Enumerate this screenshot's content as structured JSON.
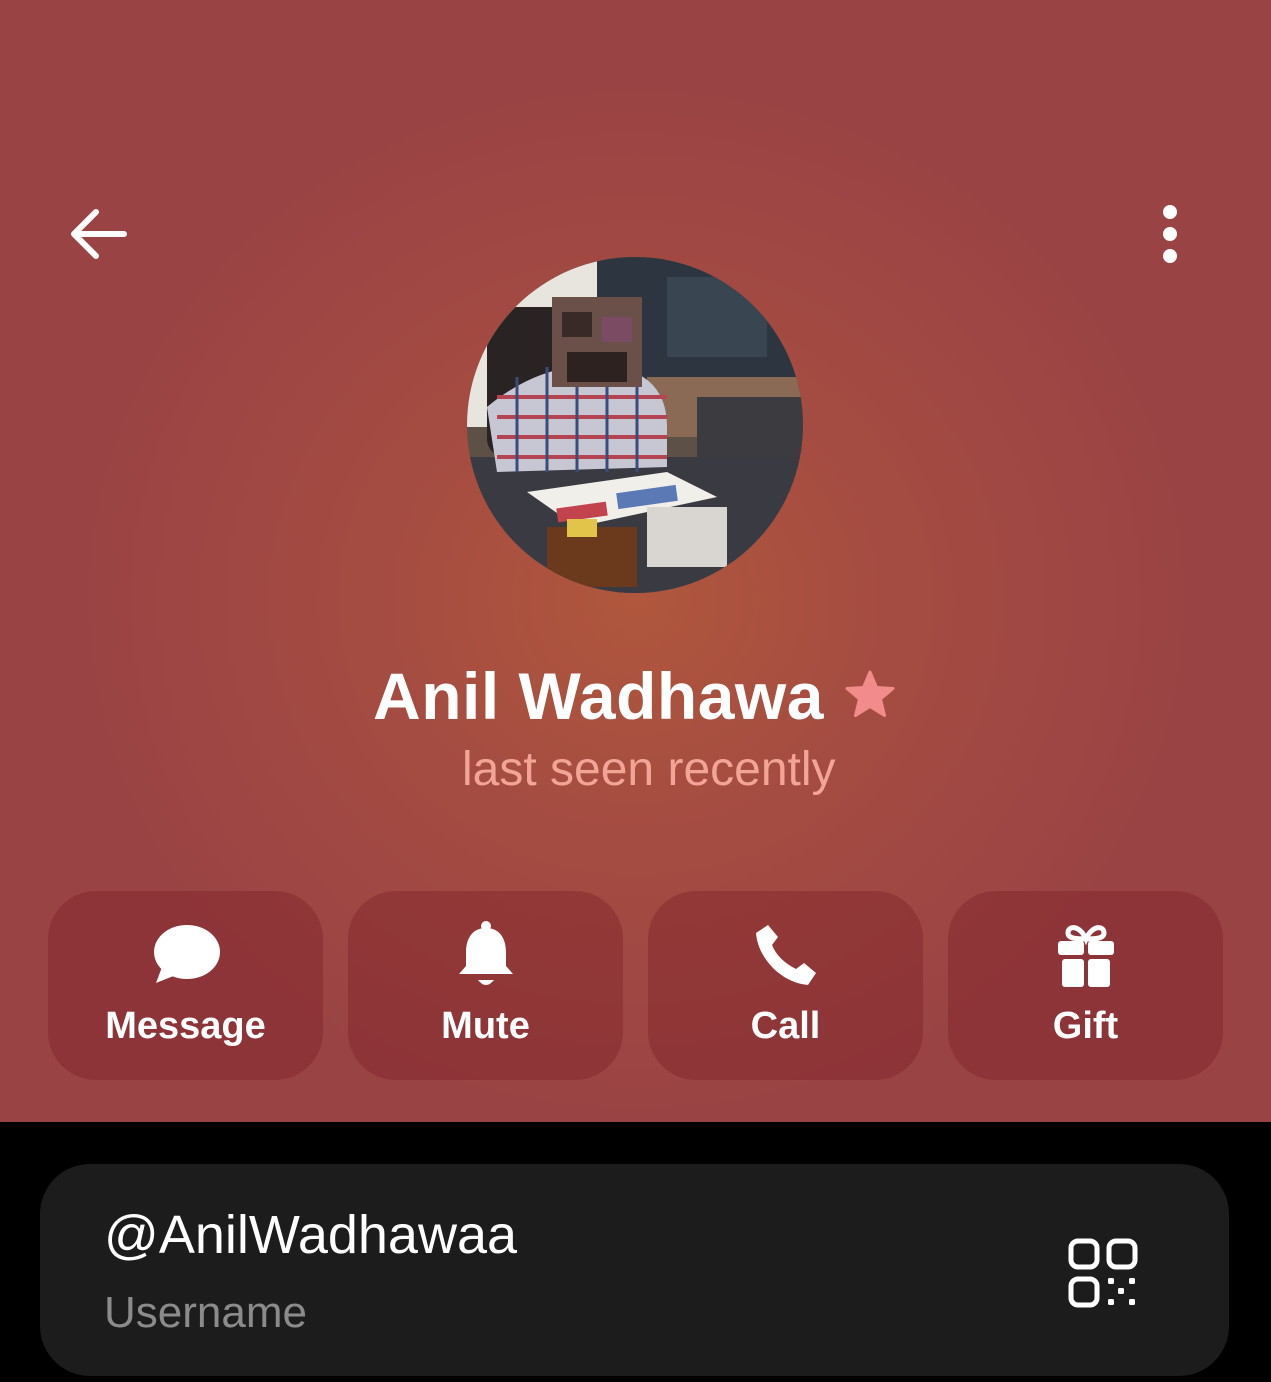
{
  "profile": {
    "name": "Anil Wadhawa",
    "status": "last seen recently"
  },
  "actions": [
    {
      "label": "Message",
      "icon": "chat-bubble-icon"
    },
    {
      "label": "Mute",
      "icon": "bell-icon"
    },
    {
      "label": "Call",
      "icon": "phone-icon"
    },
    {
      "label": "Gift",
      "icon": "gift-icon"
    }
  ],
  "info": {
    "username": "@AnilWadhawaa",
    "username_label": "Username"
  },
  "colors": {
    "header_bg": "#a54c42",
    "status_text": "#f2a597",
    "star": "#f28b8b",
    "card_bg": "#1c1c1c",
    "secondary_text": "#8b8b8b"
  },
  "icons": {
    "back": "arrow-left-icon",
    "more": "more-vertical-icon",
    "premium": "star-icon",
    "qr": "qr-code-icon"
  }
}
